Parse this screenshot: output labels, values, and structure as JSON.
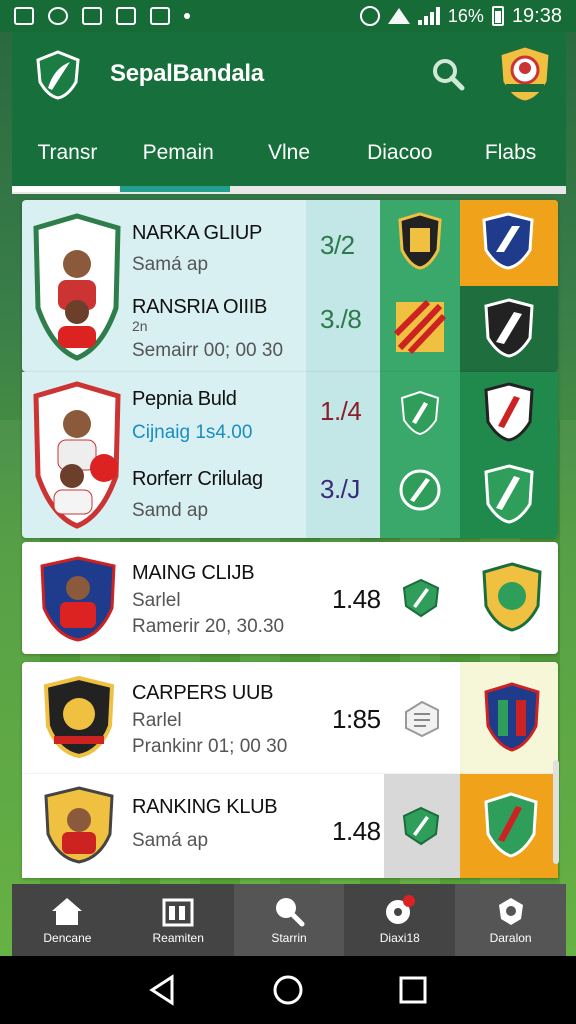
{
  "status_bar": {
    "battery": "16%",
    "time": "19:38"
  },
  "app": {
    "title": "SepalBandala"
  },
  "tabs": [
    {
      "label": "Transr"
    },
    {
      "label": "Pemain"
    },
    {
      "label": "Vlne"
    },
    {
      "label": "Diacoo"
    },
    {
      "label": "Flabs"
    }
  ],
  "matches": [
    {
      "name": "NARKA GLIUP",
      "sub": "Samá ap",
      "odd": "3/2"
    },
    {
      "name": "RANSRIA OIIIB",
      "sub_top": "2n",
      "sub": "Semairr 00; 00 30",
      "odd": "3./8"
    },
    {
      "name": "Pepnia Buld",
      "sub": "Cijnaig 1s4.00",
      "odd": "1./4"
    },
    {
      "name": "Rorferr Crilulag",
      "sub": "Samd ap",
      "odd": "3./J"
    },
    {
      "name": "MAING CLIJB",
      "sub": "Sarlel",
      "sub2": "Ramerir 20, 30.30",
      "odd": "1.48"
    },
    {
      "name": "CARPERS UUB",
      "sub": "Rarlel",
      "sub2": "Prankinr 01; 00 30",
      "odd": "1:85"
    },
    {
      "name": "RANKING KLUB",
      "sub": "Samá ap",
      "odd": "1.48"
    }
  ],
  "bottom_nav": [
    {
      "label": "Dencane",
      "icon": "home-icon"
    },
    {
      "label": "Reamiten",
      "icon": "calendar-icon"
    },
    {
      "label": "Starrin",
      "icon": "search-icon"
    },
    {
      "label": "Diaxi18",
      "icon": "ball-icon",
      "badge": "1"
    },
    {
      "label": "Daralon",
      "icon": "trophy-icon"
    }
  ],
  "colors": {
    "primary": "#176f3c",
    "accent": "#22a08d",
    "orange": "#f0a21a",
    "green_dark": "#1f8a4c"
  }
}
